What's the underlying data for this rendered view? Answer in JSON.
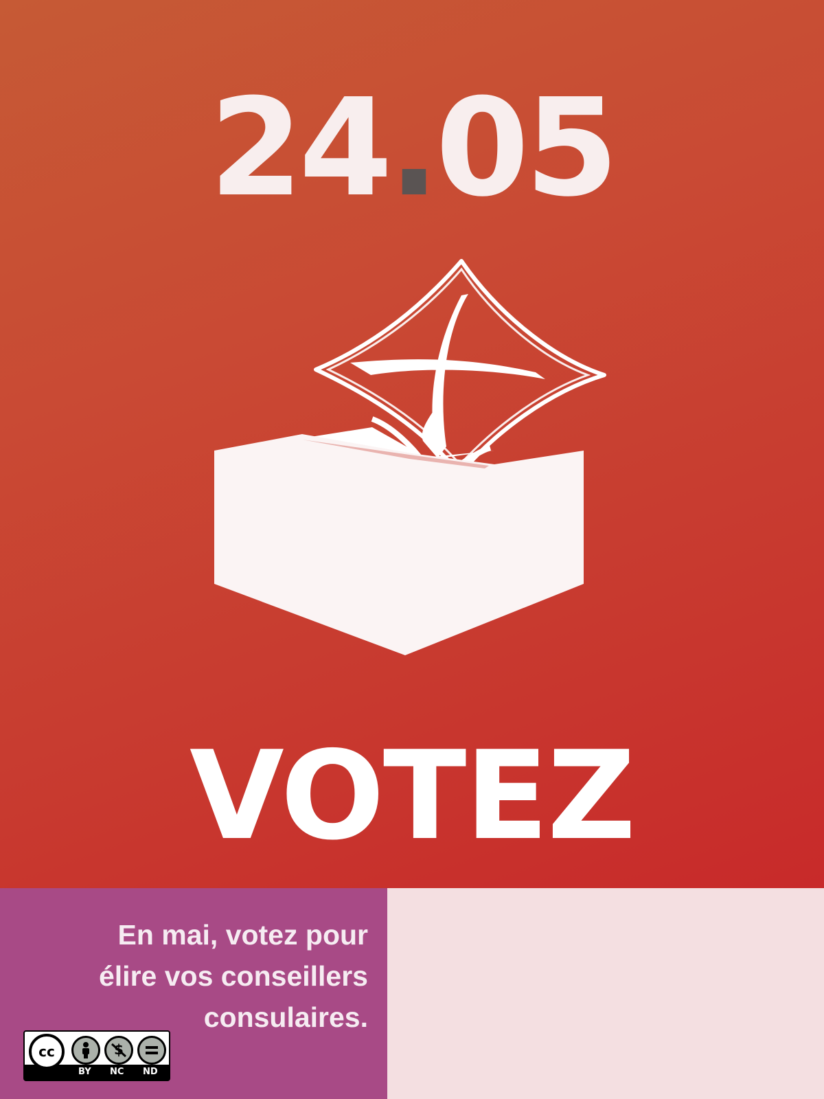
{
  "poster": {
    "date": {
      "day": "24",
      "dot": ".",
      "month": "05"
    },
    "headline": "VOTEZ"
  },
  "info": {
    "line1": "En mai, votez pour",
    "line2": "élire vos conseillers",
    "line3": "consulaires."
  },
  "license": {
    "cc": "cc",
    "labels": [
      "BY",
      "NC",
      "ND"
    ]
  },
  "colors": {
    "background_top": "#c94a34",
    "info_panel": "#a84a86",
    "right_panel": "#f4dfe1",
    "date_dot": "#5a5453"
  }
}
